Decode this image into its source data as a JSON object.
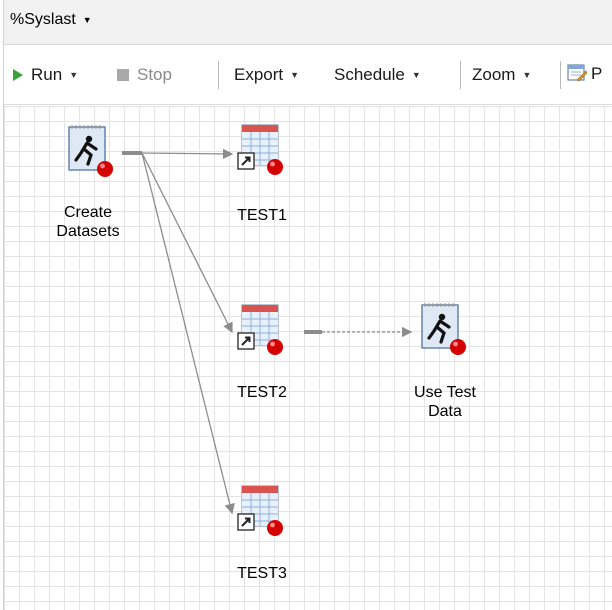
{
  "title_bar": {
    "title": "%Syslast"
  },
  "toolbar": {
    "run_label": "Run",
    "stop_label": "Stop",
    "export_label": "Export",
    "schedule_label": "Schedule",
    "zoom_label": "Zoom",
    "cut_text": "P"
  },
  "canvas": {
    "nodes": [
      {
        "id": "create-datasets",
        "label": "Create\nDatasets",
        "icon": "program-icon",
        "status": "error"
      },
      {
        "id": "test1",
        "label": "TEST1",
        "icon": "dataset-shortcut-icon",
        "status": "error"
      },
      {
        "id": "test2",
        "label": "TEST2",
        "icon": "dataset-shortcut-icon",
        "status": "error"
      },
      {
        "id": "use-test-data",
        "label": "Use Test\nData",
        "icon": "program-icon",
        "status": "error"
      },
      {
        "id": "test3",
        "label": "TEST3",
        "icon": "dataset-shortcut-icon",
        "status": "error"
      }
    ],
    "links": [
      {
        "from": "create-datasets",
        "to": "test1",
        "style": "solid"
      },
      {
        "from": "create-datasets",
        "to": "test2",
        "style": "solid"
      },
      {
        "from": "create-datasets",
        "to": "test3",
        "style": "solid"
      },
      {
        "from": "test2",
        "to": "use-test-data",
        "style": "dashed"
      }
    ]
  },
  "colors": {
    "run_icon": "#3aa23a",
    "status_badge": "#d40000",
    "link_line": "#8c8c8c"
  }
}
